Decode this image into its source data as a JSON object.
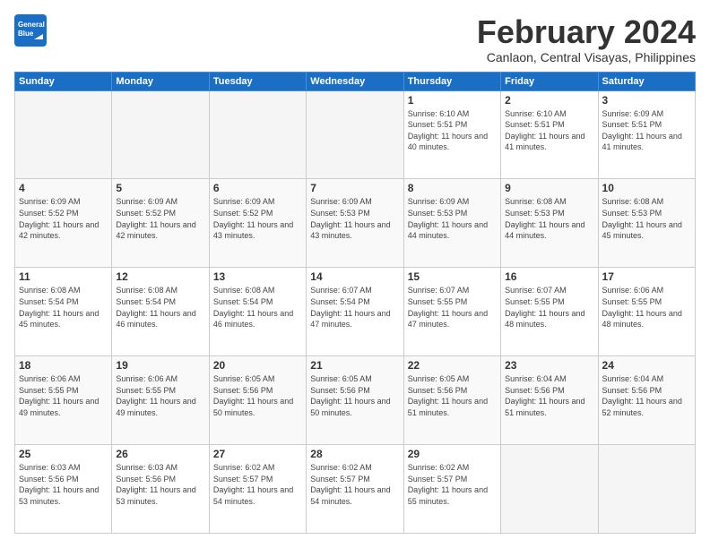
{
  "header": {
    "logo_line1": "General",
    "logo_line2": "Blue",
    "title": "February 2024",
    "subtitle": "Canlaon, Central Visayas, Philippines"
  },
  "days_of_week": [
    "Sunday",
    "Monday",
    "Tuesday",
    "Wednesday",
    "Thursday",
    "Friday",
    "Saturday"
  ],
  "weeks": [
    [
      {
        "day": "",
        "empty": true
      },
      {
        "day": "",
        "empty": true
      },
      {
        "day": "",
        "empty": true
      },
      {
        "day": "",
        "empty": true
      },
      {
        "day": "1",
        "sunrise": "6:10 AM",
        "sunset": "5:51 PM",
        "daylight": "11 hours and 40 minutes."
      },
      {
        "day": "2",
        "sunrise": "6:10 AM",
        "sunset": "5:51 PM",
        "daylight": "11 hours and 41 minutes."
      },
      {
        "day": "3",
        "sunrise": "6:09 AM",
        "sunset": "5:51 PM",
        "daylight": "11 hours and 41 minutes."
      }
    ],
    [
      {
        "day": "4",
        "sunrise": "6:09 AM",
        "sunset": "5:52 PM",
        "daylight": "11 hours and 42 minutes."
      },
      {
        "day": "5",
        "sunrise": "6:09 AM",
        "sunset": "5:52 PM",
        "daylight": "11 hours and 42 minutes."
      },
      {
        "day": "6",
        "sunrise": "6:09 AM",
        "sunset": "5:52 PM",
        "daylight": "11 hours and 43 minutes."
      },
      {
        "day": "7",
        "sunrise": "6:09 AM",
        "sunset": "5:53 PM",
        "daylight": "11 hours and 43 minutes."
      },
      {
        "day": "8",
        "sunrise": "6:09 AM",
        "sunset": "5:53 PM",
        "daylight": "11 hours and 44 minutes."
      },
      {
        "day": "9",
        "sunrise": "6:08 AM",
        "sunset": "5:53 PM",
        "daylight": "11 hours and 44 minutes."
      },
      {
        "day": "10",
        "sunrise": "6:08 AM",
        "sunset": "5:53 PM",
        "daylight": "11 hours and 45 minutes."
      }
    ],
    [
      {
        "day": "11",
        "sunrise": "6:08 AM",
        "sunset": "5:54 PM",
        "daylight": "11 hours and 45 minutes."
      },
      {
        "day": "12",
        "sunrise": "6:08 AM",
        "sunset": "5:54 PM",
        "daylight": "11 hours and 46 minutes."
      },
      {
        "day": "13",
        "sunrise": "6:08 AM",
        "sunset": "5:54 PM",
        "daylight": "11 hours and 46 minutes."
      },
      {
        "day": "14",
        "sunrise": "6:07 AM",
        "sunset": "5:54 PM",
        "daylight": "11 hours and 47 minutes."
      },
      {
        "day": "15",
        "sunrise": "6:07 AM",
        "sunset": "5:55 PM",
        "daylight": "11 hours and 47 minutes."
      },
      {
        "day": "16",
        "sunrise": "6:07 AM",
        "sunset": "5:55 PM",
        "daylight": "11 hours and 48 minutes."
      },
      {
        "day": "17",
        "sunrise": "6:06 AM",
        "sunset": "5:55 PM",
        "daylight": "11 hours and 48 minutes."
      }
    ],
    [
      {
        "day": "18",
        "sunrise": "6:06 AM",
        "sunset": "5:55 PM",
        "daylight": "11 hours and 49 minutes."
      },
      {
        "day": "19",
        "sunrise": "6:06 AM",
        "sunset": "5:55 PM",
        "daylight": "11 hours and 49 minutes."
      },
      {
        "day": "20",
        "sunrise": "6:05 AM",
        "sunset": "5:56 PM",
        "daylight": "11 hours and 50 minutes."
      },
      {
        "day": "21",
        "sunrise": "6:05 AM",
        "sunset": "5:56 PM",
        "daylight": "11 hours and 50 minutes."
      },
      {
        "day": "22",
        "sunrise": "6:05 AM",
        "sunset": "5:56 PM",
        "daylight": "11 hours and 51 minutes."
      },
      {
        "day": "23",
        "sunrise": "6:04 AM",
        "sunset": "5:56 PM",
        "daylight": "11 hours and 51 minutes."
      },
      {
        "day": "24",
        "sunrise": "6:04 AM",
        "sunset": "5:56 PM",
        "daylight": "11 hours and 52 minutes."
      }
    ],
    [
      {
        "day": "25",
        "sunrise": "6:03 AM",
        "sunset": "5:56 PM",
        "daylight": "11 hours and 53 minutes."
      },
      {
        "day": "26",
        "sunrise": "6:03 AM",
        "sunset": "5:56 PM",
        "daylight": "11 hours and 53 minutes."
      },
      {
        "day": "27",
        "sunrise": "6:02 AM",
        "sunset": "5:57 PM",
        "daylight": "11 hours and 54 minutes."
      },
      {
        "day": "28",
        "sunrise": "6:02 AM",
        "sunset": "5:57 PM",
        "daylight": "11 hours and 54 minutes."
      },
      {
        "day": "29",
        "sunrise": "6:02 AM",
        "sunset": "5:57 PM",
        "daylight": "11 hours and 55 minutes."
      },
      {
        "day": "",
        "empty": true
      },
      {
        "day": "",
        "empty": true
      }
    ]
  ]
}
